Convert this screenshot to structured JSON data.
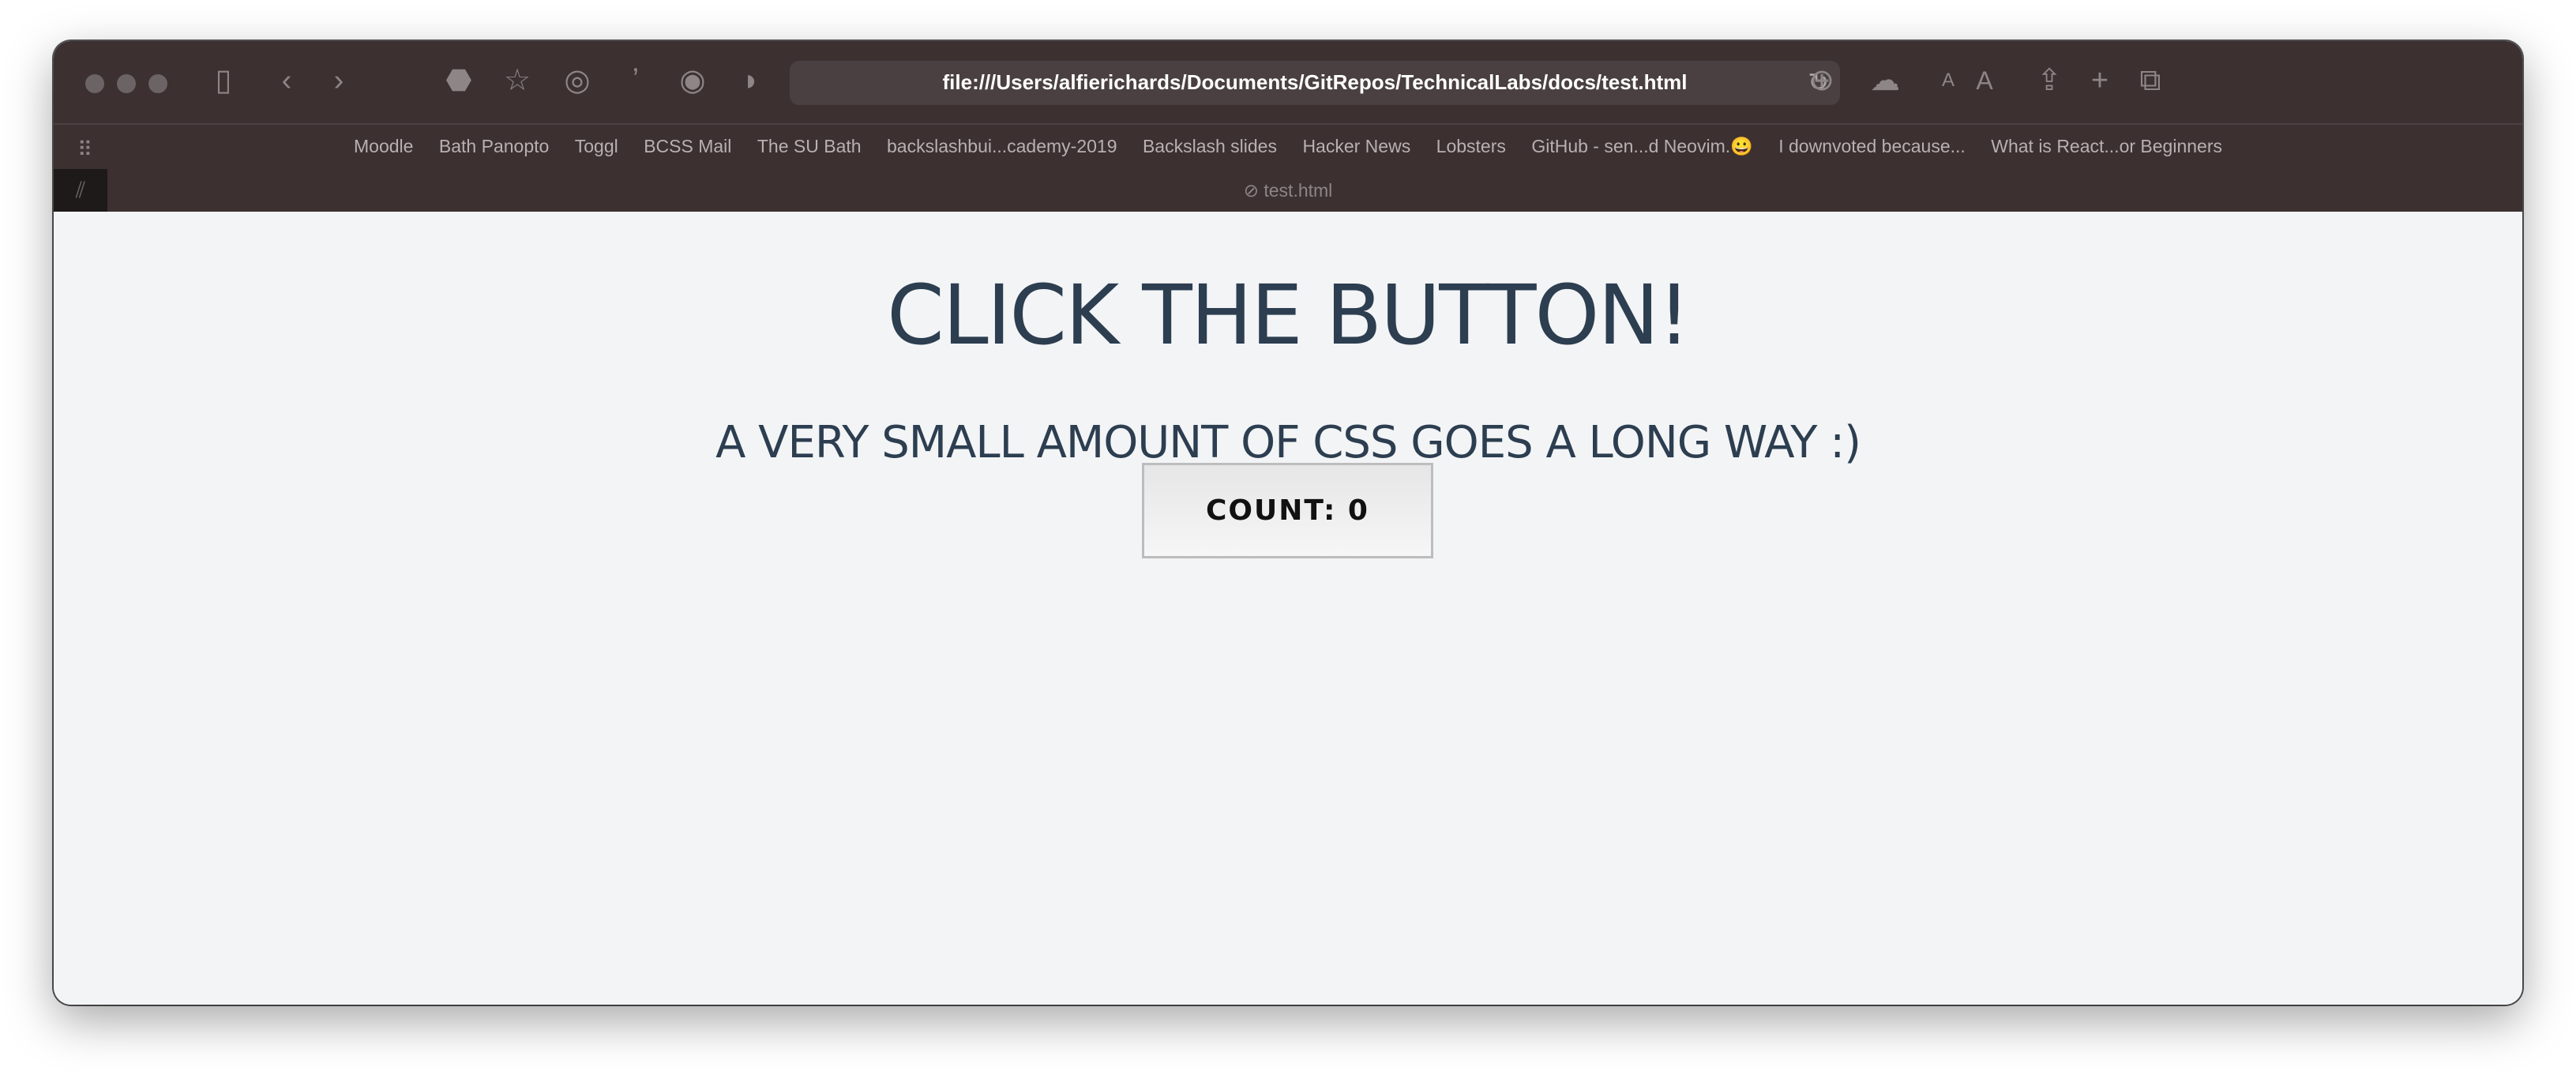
{
  "browser": {
    "url": "file:///Users/alfierichards/Documents/GitRepos/TechnicalLabs/docs/test.html",
    "tab_title": "test.html",
    "bookmarks": [
      "Moodle",
      "Bath Panopto",
      "Toggl",
      "BCSS Mail",
      "The SU Bath",
      "backslashbui...cademy-2019",
      "Backslash slides",
      "Hacker News",
      "Lobsters",
      "GitHub - sen...d Neovim.😀",
      "I downvoted because...",
      "What is React...or Beginners"
    ],
    "icons": {
      "text_small": "A",
      "text_large": "A"
    }
  },
  "page": {
    "title": "CLICK THE BUTTON!",
    "subtitle": "A VERY SMALL AMOUNT OF CSS GOES A LONG WAY :)",
    "button_label": "COUNT: 0"
  },
  "colors": {
    "text": "#2c3e50",
    "background": "#f3f4f6",
    "chrome": "#3c3031"
  }
}
